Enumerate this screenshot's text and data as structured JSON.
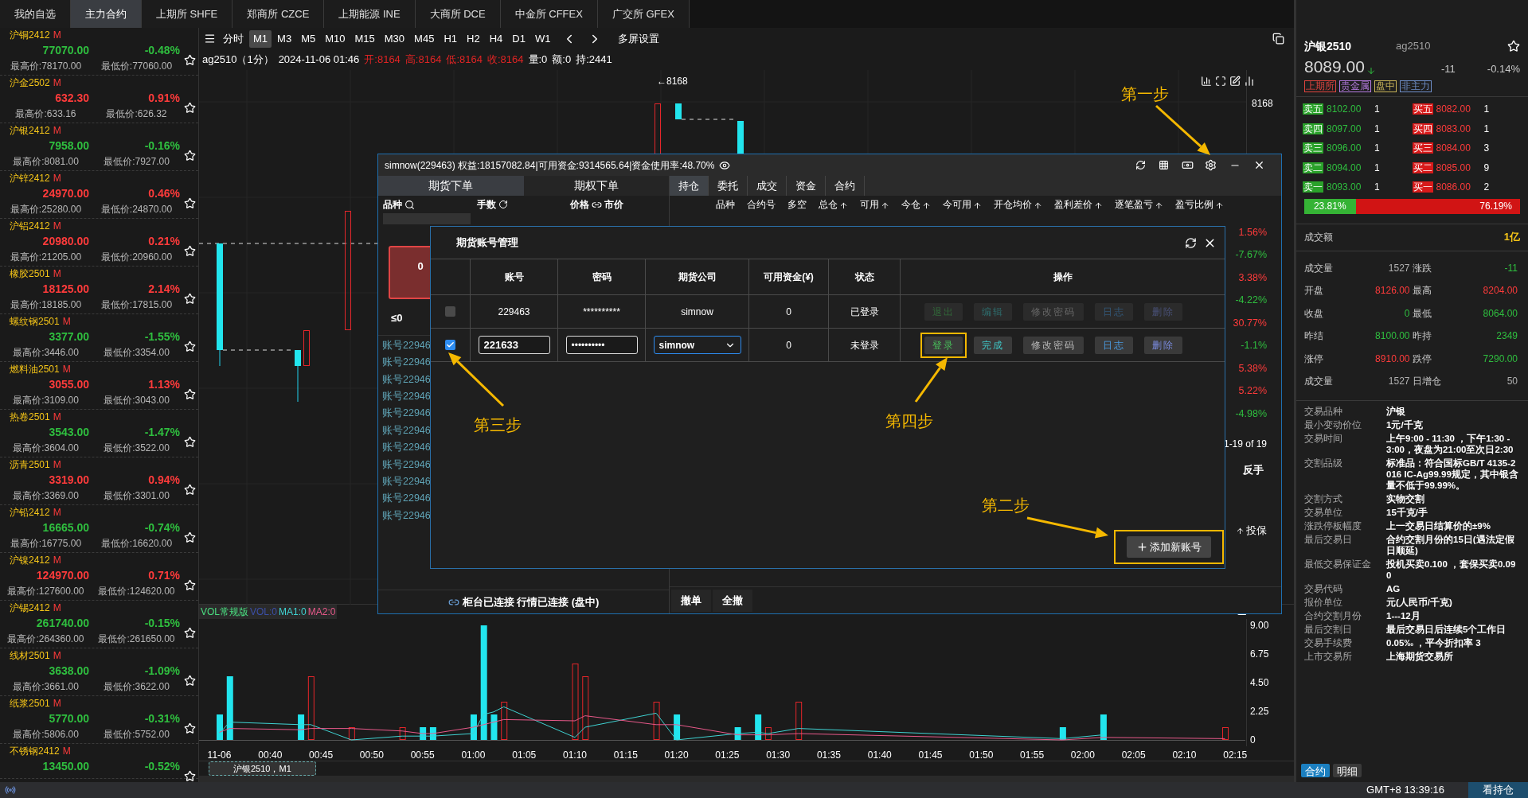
{
  "top_tabs": [
    {
      "label": "我的自选",
      "selected": false
    },
    {
      "label": "主力合约",
      "selected": true
    },
    {
      "label": "上期所 SHFE",
      "selected": false
    },
    {
      "label": "郑商所 CZCE",
      "selected": false
    },
    {
      "label": "上期能源 INE",
      "selected": false
    },
    {
      "label": "大商所 DCE",
      "selected": false
    },
    {
      "label": "中金所 CFFEX",
      "selected": false
    },
    {
      "label": "广交所 GFEX",
      "selected": false
    }
  ],
  "watchlist": [
    {
      "name": "沪铜2412",
      "tag": "M",
      "price": "77070.00",
      "change": "-0.48%",
      "kind": "down",
      "high": "最高价:78170.00",
      "low": "最低价:77060.00"
    },
    {
      "name": "沪金2502",
      "tag": "M",
      "price": "632.30",
      "change": "0.91%",
      "kind": "up",
      "high": "最高价:633.16",
      "low": "最低价:626.32"
    },
    {
      "name": "沪银2412",
      "tag": "M",
      "price": "7958.00",
      "change": "-0.16%",
      "kind": "down",
      "high": "最高价:8081.00",
      "low": "最低价:7927.00"
    },
    {
      "name": "沪锌2412",
      "tag": "M",
      "price": "24970.00",
      "change": "0.46%",
      "kind": "up",
      "high": "最高价:25280.00",
      "low": "最低价:24870.00"
    },
    {
      "name": "沪铝2412",
      "tag": "M",
      "price": "20980.00",
      "change": "0.21%",
      "kind": "up",
      "high": "最高价:21205.00",
      "low": "最低价:20960.00"
    },
    {
      "name": "橡胶2501",
      "tag": "M",
      "price": "18125.00",
      "change": "2.14%",
      "kind": "up",
      "high": "最高价:18185.00",
      "low": "最低价:17815.00"
    },
    {
      "name": "螺纹钢2501",
      "tag": "M",
      "price": "3377.00",
      "change": "-1.55%",
      "kind": "down",
      "high": "最高价:3446.00",
      "low": "最低价:3354.00"
    },
    {
      "name": "燃料油2501",
      "tag": "M",
      "price": "3055.00",
      "change": "1.13%",
      "kind": "up",
      "high": "最高价:3109.00",
      "low": "最低价:3043.00"
    },
    {
      "name": "热卷2501",
      "tag": "M",
      "price": "3543.00",
      "change": "-1.47%",
      "kind": "down",
      "high": "最高价:3604.00",
      "low": "最低价:3522.00"
    },
    {
      "name": "沥青2501",
      "tag": "M",
      "price": "3319.00",
      "change": "0.94%",
      "kind": "up",
      "high": "最高价:3369.00",
      "low": "最低价:3301.00"
    },
    {
      "name": "沪铅2412",
      "tag": "M",
      "price": "16665.00",
      "change": "-0.74%",
      "kind": "down",
      "high": "最高价:16775.00",
      "low": "最低价:16620.00"
    },
    {
      "name": "沪镍2412",
      "tag": "M",
      "price": "124970.00",
      "change": "0.71%",
      "kind": "up",
      "high": "最高价:127600.00",
      "low": "最低价:124620.00"
    },
    {
      "name": "沪锡2412",
      "tag": "M",
      "price": "261740.00",
      "change": "-0.15%",
      "kind": "down",
      "high": "最高价:264360.00",
      "low": "最低价:261650.00"
    },
    {
      "name": "线材2501",
      "tag": "M",
      "price": "3638.00",
      "change": "-1.09%",
      "kind": "down",
      "high": "最高价:3661.00",
      "low": "最低价:3622.00"
    },
    {
      "name": "纸浆2501",
      "tag": "M",
      "price": "5770.00",
      "change": "-0.31%",
      "kind": "down",
      "high": "最高价:5806.00",
      "low": "最低价:5752.00"
    },
    {
      "name": "不锈钢2412",
      "tag": "M",
      "price": "13450.00",
      "change": "-0.52%",
      "kind": "down"
    }
  ],
  "periods": [
    {
      "label": "分时",
      "selected": false
    },
    {
      "label": "M1",
      "selected": true
    },
    {
      "label": "M3",
      "selected": false
    },
    {
      "label": "M5",
      "selected": false
    },
    {
      "label": "M10",
      "selected": false
    },
    {
      "label": "M15",
      "selected": false
    },
    {
      "label": "M30",
      "selected": false
    },
    {
      "label": "M45",
      "selected": false
    },
    {
      "label": "H1",
      "selected": false
    },
    {
      "label": "H2",
      "selected": false
    },
    {
      "label": "H4",
      "selected": false
    },
    {
      "label": "D1",
      "selected": false
    },
    {
      "label": "W1",
      "selected": false
    }
  ],
  "multi_screen": "多屏设置",
  "chart_info": [
    {
      "text": "ag2510（1分）",
      "kind": "plain"
    },
    {
      "text": "2024-11-06 01:46",
      "kind": "plain"
    },
    {
      "text": "开:8164",
      "kind": "up"
    },
    {
      "text": "高:8164",
      "kind": "up"
    },
    {
      "text": "低:8164",
      "kind": "up"
    },
    {
      "text": "收:8164",
      "kind": "up"
    },
    {
      "text": "量:0",
      "kind": "plain"
    },
    {
      "text": "额:0",
      "kind": "plain"
    },
    {
      "text": "持:2441",
      "kind": "plain"
    }
  ],
  "price_axis_label": "8168",
  "price_marker": "←8168",
  "volume_legend": [
    {
      "text": "VOL常规版",
      "color": "#4ade80"
    },
    {
      "text": "VOL:0",
      "color": "#3b4fa8"
    },
    {
      "text": "MA1:0",
      "color": "#3fd3d3"
    },
    {
      "text": "MA2:0",
      "color": "#e8598a"
    }
  ],
  "volume_chart": {
    "chart_data": {
      "type": "bar",
      "x": [
        35,
        36,
        43,
        44,
        48,
        53,
        55,
        56,
        60,
        61,
        62,
        63,
        70,
        71,
        78,
        80,
        86,
        88,
        89,
        92,
        118,
        122,
        134
      ],
      "series": [
        {
          "type": "bar",
          "color": "#22e5ee",
          "values": [
            2,
            5,
            2,
            null,
            null,
            null,
            1,
            1,
            2,
            9,
            2,
            null,
            null,
            null,
            null,
            2,
            1,
            2,
            null,
            null,
            1,
            2,
            null
          ]
        },
        {
          "type": "bar",
          "color": "#e5262a",
          "values": [
            null,
            null,
            null,
            5,
            1,
            1,
            null,
            null,
            null,
            null,
            null,
            3,
            6,
            5,
            3,
            null,
            null,
            null,
            1,
            3,
            null,
            null,
            1
          ]
        },
        {
          "type": "line",
          "color": "#3fd3d3",
          "values": [
            0.5,
            1.4,
            1.2,
            1.2,
            0,
            0.3,
            0.3,
            0.3,
            0.5,
            2,
            2.2,
            2.6,
            0.2,
            1,
            2.1,
            0,
            0.5,
            0.6,
            0.5,
            0.9,
            0.1,
            0.4,
            null
          ]
        },
        {
          "type": "line",
          "color": "#e8598a",
          "values": [
            0.6,
            0.9,
            0.8,
            0.9,
            0.9,
            0.7,
            0.5,
            0.5,
            1,
            1.2,
            1.4,
            1.6,
            1.5,
            1.9,
            1.2,
            1.2,
            0.4,
            0.4,
            0.4,
            0.5,
            0,
            0.2,
            0.1
          ]
        }
      ],
      "xlim": [
        33,
        136
      ],
      "ylim": [
        0,
        9.5
      ],
      "xticks": [
        {
          "value": 35,
          "label": "11-06"
        },
        {
          "value": 40,
          "label": "00:40"
        },
        {
          "value": 45,
          "label": "00:45"
        },
        {
          "value": 50,
          "label": "00:50"
        },
        {
          "value": 55,
          "label": "00:55"
        },
        {
          "value": 60,
          "label": "01:00"
        },
        {
          "value": 65,
          "label": "01:05"
        },
        {
          "value": 70,
          "label": "01:10"
        },
        {
          "value": 75,
          "label": "01:15"
        },
        {
          "value": 80,
          "label": "01:20"
        },
        {
          "value": 85,
          "label": "01:25"
        },
        {
          "value": 90,
          "label": "01:30"
        },
        {
          "value": 95,
          "label": "01:35"
        },
        {
          "value": 100,
          "label": "01:40"
        },
        {
          "value": 105,
          "label": "01:45"
        },
        {
          "value": 110,
          "label": "01:50"
        },
        {
          "value": 115,
          "label": "01:55"
        },
        {
          "value": 120,
          "label": "02:00"
        },
        {
          "value": 125,
          "label": "02:05"
        },
        {
          "value": 130,
          "label": "02:10"
        },
        {
          "value": 135,
          "label": "02:15"
        }
      ],
      "yticks": [
        {
          "value": 9,
          "label": "9.00"
        },
        {
          "value": 6.75,
          "label": "6.75"
        },
        {
          "value": 4.5,
          "label": "4.50"
        },
        {
          "value": 2.25,
          "label": "2.25"
        },
        {
          "value": 0,
          "label": "0"
        }
      ]
    }
  },
  "chart_caption": "沪银2510，M1",
  "trade_window": {
    "title": "simnow(229463) 权益:18157082.84|可用资金:9314565.64|资金使用率:48.70%",
    "order_tabs": [
      {
        "label": "期货下单",
        "selected": true
      },
      {
        "label": "期权下单",
        "selected": false
      }
    ],
    "order_fields": [
      {
        "label": "品种",
        "kind": "search"
      },
      {
        "label": "手数",
        "kind": "reset"
      },
      {
        "label": "价格",
        "kind": "link",
        "extra": "市价"
      }
    ],
    "order_button": "0",
    "limit_text": "≤0",
    "accounts": [
      "账号22946",
      "账号22946",
      "账号22946",
      "账号22946",
      "账号22946",
      "账号22946",
      "账号22946",
      "账号22946",
      "账号22946",
      "账号22946",
      "账号22946"
    ],
    "connection": "柜台已连接 行情已连接 (盘中)",
    "position_tabs": [
      {
        "label": "持仓",
        "selected": true
      },
      {
        "label": "委托",
        "selected": false
      },
      {
        "label": "成交",
        "selected": false
      },
      {
        "label": "资金",
        "selected": false
      },
      {
        "label": "合约",
        "selected": false
      }
    ],
    "columns": [
      {
        "label": "品种",
        "sortable": false
      },
      {
        "label": "合约号",
        "sortable": false
      },
      {
        "label": "多空",
        "sortable": false
      },
      {
        "label": "总仓",
        "sortable": true
      },
      {
        "label": "可用",
        "sortable": true
      },
      {
        "label": "今仓",
        "sortable": true
      },
      {
        "label": "今可用",
        "sortable": true
      },
      {
        "label": "开仓均价",
        "sortable": true
      },
      {
        "label": "盈利差价",
        "sortable": true
      },
      {
        "label": "逐笔盈亏",
        "sortable": true
      },
      {
        "label": "盈亏比例",
        "sortable": true
      }
    ],
    "ratios": [
      {
        "text": "1.56%",
        "kind": "up"
      },
      {
        "text": "-7.67%",
        "kind": "down"
      },
      {
        "text": "3.38%",
        "kind": "up"
      },
      {
        "text": "-4.22%",
        "kind": "down"
      },
      {
        "text": "30.77%",
        "kind": "up"
      },
      {
        "text": "-1.1%",
        "kind": "down"
      },
      {
        "text": "5.38%",
        "kind": "up"
      },
      {
        "text": "5.22%",
        "kind": "up"
      },
      {
        "text": "-4.98%",
        "kind": "down"
      }
    ],
    "pagination": "1-19 of 19",
    "reverse_button": "反手",
    "hedge": "投保",
    "bottom_buttons": [
      "撤单",
      "全撤"
    ]
  },
  "account_dialog": {
    "title": "期货账号管理",
    "columns": [
      "账号",
      "密码",
      "期货公司",
      "可用资金(¥)",
      "状态",
      "操作"
    ],
    "rows": [
      {
        "checked": false,
        "editing": false,
        "account": "229463",
        "password": "**********",
        "broker": "simnow",
        "funds": "0",
        "status": "已登录",
        "actions": [
          {
            "label": "退出",
            "kind": "logout",
            "enabled": false,
            "highlighted": false
          },
          {
            "label": "编辑",
            "kind": "edit",
            "enabled": false,
            "highlighted": false
          },
          {
            "label": "修改密码",
            "kind": "password",
            "enabled": false,
            "highlighted": false
          },
          {
            "label": "日志",
            "kind": "log",
            "enabled": false,
            "highlighted": false
          },
          {
            "label": "删除",
            "kind": "delete",
            "enabled": false,
            "highlighted": false
          }
        ]
      },
      {
        "checked": true,
        "editing": true,
        "account": "221633",
        "password": "••••••••••",
        "broker": "simnow",
        "funds": "0",
        "status": "未登录",
        "actions": [
          {
            "label": "登录",
            "kind": "login",
            "enabled": true,
            "highlighted": true
          },
          {
            "label": "完成",
            "kind": "edit",
            "enabled": true,
            "highlighted": false
          },
          {
            "label": "修改密码",
            "kind": "password",
            "enabled": true,
            "highlighted": false
          },
          {
            "label": "日志",
            "kind": "log",
            "enabled": true,
            "highlighted": false
          },
          {
            "label": "删除",
            "kind": "delete",
            "enabled": true,
            "highlighted": false
          }
        ]
      }
    ],
    "add_button": {
      "label": "添加新账号",
      "highlighted": true
    }
  },
  "annotations": [
    "第一步",
    "第二步",
    "第三步",
    "第四步"
  ],
  "quote": {
    "name": "沪银2510",
    "code": "ag2510",
    "price": "8089.00",
    "rising": false,
    "change": "-11",
    "change_pct": "-0.14%",
    "tags": [
      {
        "text": "上期所",
        "color": "#e0443e"
      },
      {
        "text": "贵金属",
        "color": "#b57be0"
      },
      {
        "text": "盘中",
        "color": "#c9b458"
      },
      {
        "text": "非主力",
        "color": "#6f8fc9"
      }
    ],
    "asks": [
      {
        "label": "卖五",
        "price": "8102.00",
        "volume": "1"
      },
      {
        "label": "卖四",
        "price": "8097.00",
        "volume": "1"
      },
      {
        "label": "卖三",
        "price": "8096.00",
        "volume": "1"
      },
      {
        "label": "卖二",
        "price": "8094.00",
        "volume": "1"
      },
      {
        "label": "卖一",
        "price": "8093.00",
        "volume": "1"
      }
    ],
    "bids": [
      {
        "label": "买五",
        "price": "8082.00",
        "volume": "1"
      },
      {
        "label": "买四",
        "price": "8083.00",
        "volume": "1"
      },
      {
        "label": "买三",
        "price": "8084.00",
        "volume": "3"
      },
      {
        "label": "买二",
        "price": "8085.00",
        "volume": "9"
      },
      {
        "label": "买一",
        "price": "8086.00",
        "volume": "2"
      }
    ],
    "ratio": {
      "buy": "23.81%",
      "sell": "76.19%",
      "level": 0.2381
    },
    "turnover": {
      "label": "成交额",
      "value": "1亿"
    },
    "stats": [
      {
        "label": "成交量",
        "value": "1527",
        "kind": "plain"
      },
      {
        "label": "涨跌",
        "value": "-11",
        "kind": "down"
      },
      {
        "label": "开盘",
        "value": "8126.00",
        "kind": "up"
      },
      {
        "label": "最高",
        "value": "8204.00",
        "kind": "up"
      },
      {
        "label": "收盘",
        "value": "0",
        "kind": "down"
      },
      {
        "label": "最低",
        "value": "8064.00",
        "kind": "down"
      },
      {
        "label": "昨结",
        "value": "8100.00",
        "kind": "down"
      },
      {
        "label": "昨持",
        "value": "2349",
        "kind": "down"
      },
      {
        "label": "涨停",
        "value": "8910.00",
        "kind": "up"
      },
      {
        "label": "跌停",
        "value": "7290.00",
        "kind": "down"
      },
      {
        "label": "成交量",
        "value": "1527",
        "kind": "plain"
      },
      {
        "label": "日增仓",
        "value": "50",
        "kind": "plain"
      }
    ],
    "info": [
      {
        "key": "交易品种",
        "value": "沪银"
      },
      {
        "key": "最小变动价位",
        "value": "1元/千克"
      },
      {
        "key": "交易时间",
        "value": "上午9:00 - 11:30 ，下午1:30 - 3:00，夜盘为21:00至次日2:30"
      },
      {
        "key": "交割品级",
        "value": "标准品：符合国标GB/T 4135-2016 IC-Ag99.99规定，其中银含量不低于99.99%。"
      },
      {
        "key": "交割方式",
        "value": "实物交割"
      },
      {
        "key": "交易单位",
        "value": "15千克/手"
      },
      {
        "key": "涨跌停板幅度",
        "value": "上一交易日结算价的±9%"
      },
      {
        "key": "最后交易日",
        "value": "合约交割月份的15日(遇法定假日顺延)"
      },
      {
        "key": "最低交易保证金",
        "value": "投机买卖0.100 ，套保买卖0.090"
      },
      {
        "key": "交易代码",
        "value": "AG"
      },
      {
        "key": "报价单位",
        "value": "元(人民币/千克)"
      },
      {
        "key": "合约交割月份",
        "value": "1---12月"
      },
      {
        "key": "最后交割日",
        "value": "最后交易日后连续5个工作日"
      },
      {
        "key": "交易手续费",
        "value": "0.05‰ ，平今折扣率 3"
      },
      {
        "key": "上市交易所",
        "value": "上海期货交易所"
      }
    ],
    "bottom_tabs": [
      {
        "label": "合约",
        "selected": true
      },
      {
        "label": "明细",
        "selected": false
      }
    ]
  },
  "status_bar": {
    "time": "GMT+8 13:39:16",
    "button": "看持仓"
  }
}
